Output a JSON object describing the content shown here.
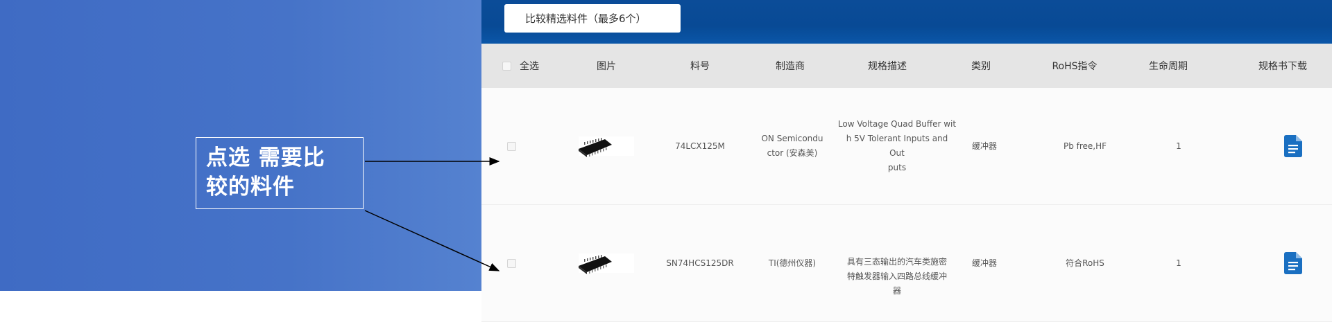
{
  "annotation": {
    "line1": "点选 需要比",
    "line2": "较的料件"
  },
  "toolbar": {
    "compare_label": "比较精选料件（最多6个）"
  },
  "table": {
    "headers": {
      "select_all": "全选",
      "image": "图片",
      "part_number": "料号",
      "manufacturer": "制造商",
      "description": "规格描述",
      "category": "类别",
      "rohs": "RoHS指令",
      "lifecycle": "生命周期",
      "datasheet": "规格书下载"
    },
    "rows": [
      {
        "part_number": "74LCX125M",
        "manufacturer_line1": "ON Semicondu",
        "manufacturer_line2": "ctor (安森美)",
        "desc_line1": "Low Voltage Quad Buffer wit",
        "desc_line2": "h 5V Tolerant Inputs and Out",
        "desc_line3": "puts",
        "category": "缓冲器",
        "rohs": "Pb free,HF",
        "lifecycle": "1"
      },
      {
        "part_number": "SN74HCS125DR",
        "manufacturer_line1": "TI(德州仪器)",
        "manufacturer_line2": "",
        "desc_line1": "具有三态输出的汽车类施密",
        "desc_line2": "特触发器输入四路总线缓冲",
        "desc_line3": "器",
        "category": "缓冲器",
        "rohs": "符合RoHS",
        "lifecycle": "1"
      }
    ]
  },
  "colors": {
    "left_panel": "#4673c8",
    "top_bar": "#0b4c98",
    "doc_icon": "#1a6fc1"
  },
  "icons": {
    "datasheet": "document-icon",
    "checkbox": "checkbox-icon"
  }
}
